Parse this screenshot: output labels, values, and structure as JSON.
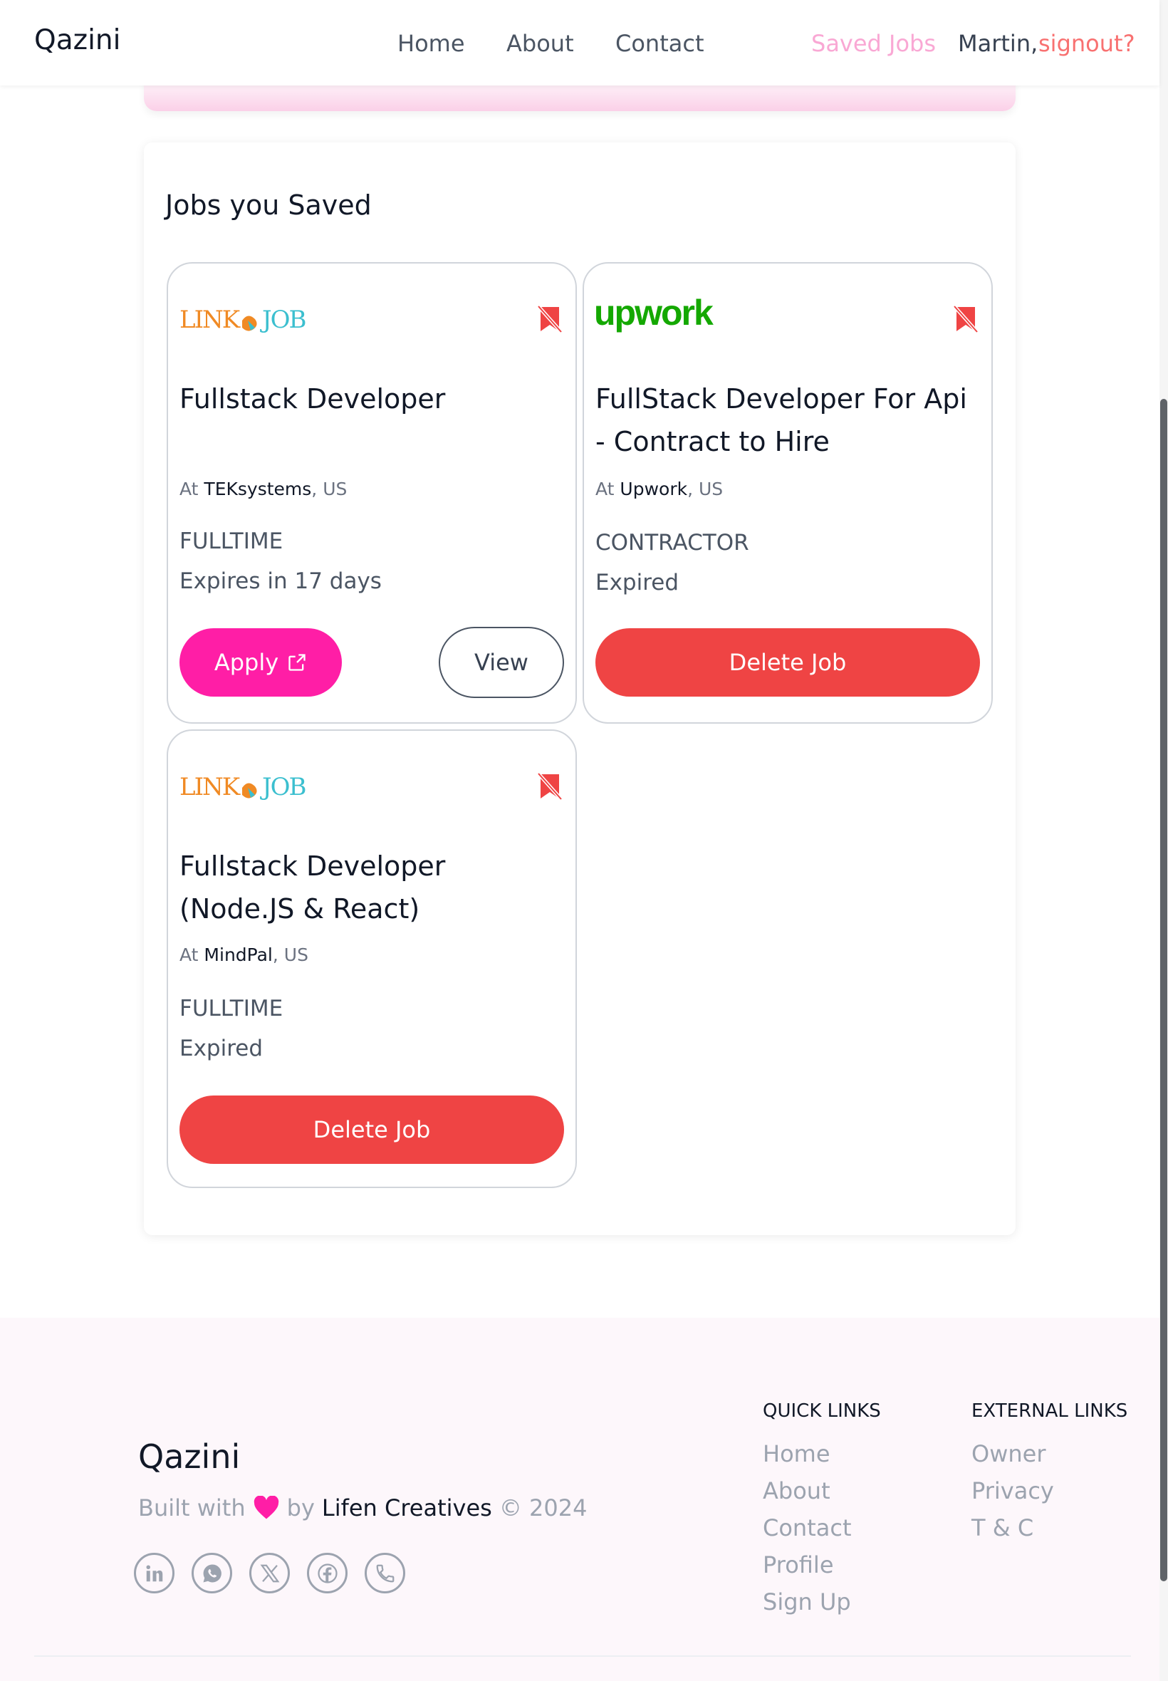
{
  "header": {
    "brand": "Qazini",
    "nav": [
      "Home",
      "About",
      "Contact"
    ],
    "saved_jobs": "Saved Jobs",
    "user_name": "Martin,",
    "signout": "signout?"
  },
  "main": {
    "title": "Jobs you Saved",
    "cards": [
      {
        "logo": "LINK JOB",
        "title": "Fullstack Developer",
        "at_label": "At",
        "company": "TEKsystems",
        "location": ", US",
        "type": "FULLTIME",
        "expiry": "Expires in 17 days",
        "apply_label": "Apply",
        "view_label": "View"
      },
      {
        "logo": "upwork",
        "title": "FullStack Developer For Api - Contract to Hire",
        "at_label": "At",
        "company": "Upwork",
        "location": ", US",
        "type": "CONTRACTOR",
        "expiry": "Expired",
        "delete_label": "Delete Job"
      },
      {
        "logo": "LINK JOB",
        "title": "Fullstack Developer (Node.JS & React)",
        "at_label": "At",
        "company": "MindPal",
        "location": ", US",
        "type": "FULLTIME",
        "expiry": "Expired",
        "delete_label": "Delete Job"
      }
    ]
  },
  "footer": {
    "brand": "Qazini",
    "built_with": "Built with",
    "by": "by",
    "maker": "Lifen Creatives",
    "copyright": "© 2024",
    "socials": [
      "linkedin-icon",
      "whatsapp-icon",
      "x-icon",
      "facebook-icon",
      "phone-icon"
    ],
    "quick_links_title": "QUICK LINKS",
    "quick_links": [
      "Home",
      "About",
      "Contact",
      "Profile",
      "Sign Up"
    ],
    "external_links_title": "EXTERNAL LINKS",
    "external_links": [
      "Owner",
      "Privacy",
      "T & C"
    ]
  },
  "colors": {
    "accent_pink": "#ff1ea6",
    "delete_red": "#ef4444",
    "saved_jobs_pink": "#f9a8d4",
    "signout_red": "#f87171",
    "upwork_green": "#14a800",
    "linkjob_orange": "#f08a24",
    "linkjob_teal": "#3bbfcf"
  }
}
